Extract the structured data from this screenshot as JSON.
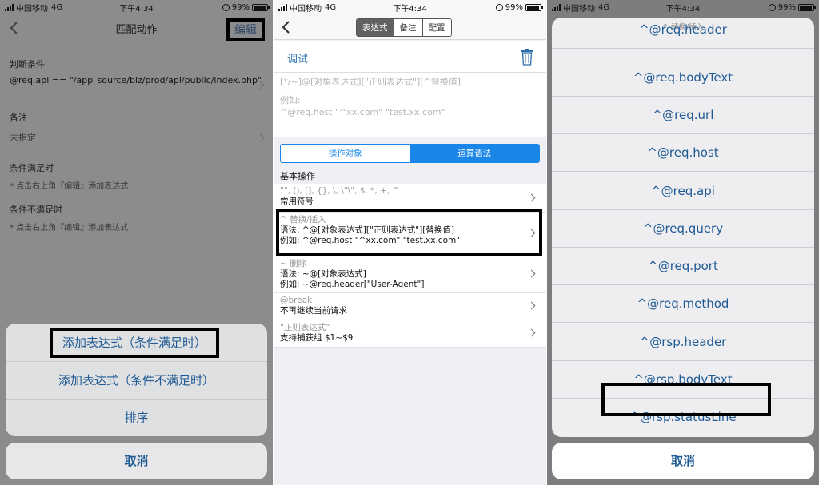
{
  "status": {
    "carrier": "中国移动",
    "network": "4G",
    "time": "下午4:34",
    "battery": "99%"
  },
  "panel1": {
    "title": "匹配动作",
    "edit_label": "编辑",
    "section_condition": "判断条件",
    "condition_value": "@req.api == \"/app_source/biz/prod/api/public/index.php\"",
    "section_note": "备注",
    "note_placeholder": "未指定",
    "section_true": "条件满足时",
    "hint_true": "* 点击右上角『编辑』添加表达式",
    "section_false": "条件不满足时",
    "hint_false": "* 点击右上角『编辑』添加表达式",
    "sheet_items": [
      "添加表达式（条件满足时）",
      "添加表达式（条件不满足时）",
      "排序"
    ],
    "cancel": "取消"
  },
  "panel2": {
    "segments": [
      "表达式",
      "备注",
      "配置"
    ],
    "debug_label": "调试",
    "editor_placeholder": "[*/~]@[对象表达式][\"正则表达式\"][^替换值]",
    "example_label": "例如:",
    "example_value": "^@req.host \"^xx.com\" \"test.xx.com\"",
    "tabs": [
      "操作对象",
      "运算语法"
    ],
    "basic_title": "基本操作",
    "ops": [
      {
        "t": "\"\", (), [], {}, \\, \\\"\\\", $, *, +, ^",
        "d": "常用符号"
      },
      {
        "t": "^ 替换/插入",
        "d": "语法: ^@[对象表达式][\"正则表达式\"][替换值]",
        "e": "例如: ^@req.host \"^xx.com\" \"test.xx.com\""
      },
      {
        "t": "~ 删除",
        "d": "语法: ~@[对象表达式]",
        "e": "例如: ~@req.header[\"User-Agent\"]"
      },
      {
        "t": "@break",
        "d": "不再继续当前请求"
      },
      {
        "t": "\"正则表达式\"",
        "d": "支持捕获组 $1~$9"
      }
    ]
  },
  "panel3": {
    "title": "^ 替换/插入",
    "options": [
      "^@req.header",
      "^@req.bodyText",
      "^@req.url",
      "^@req.host",
      "^@req.api",
      "^@req.query",
      "^@req.port",
      "^@req.method",
      "^@rsp.header",
      "^@rsp.bodyText",
      "^@rsp.statusLine"
    ],
    "cancel": "取消"
  },
  "colors": {
    "accent": "#1a86e8",
    "link": "#1f5a95"
  }
}
